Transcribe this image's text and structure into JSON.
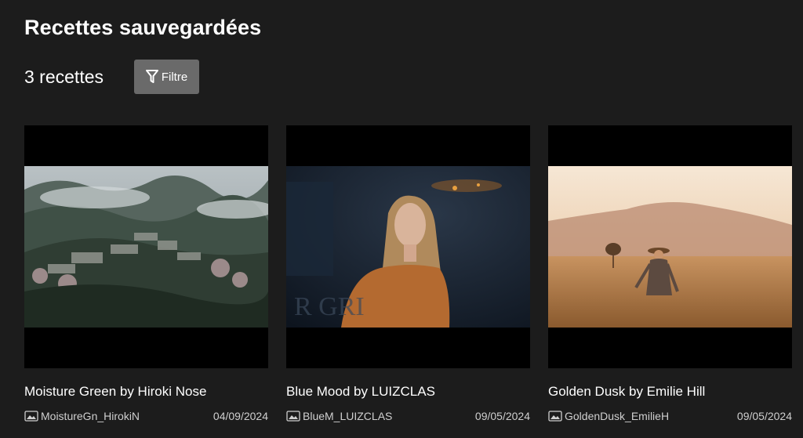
{
  "header": {
    "title": "Recettes sauvegardées",
    "count": "3 recettes",
    "filter_label": "Filtre"
  },
  "recipes": [
    {
      "title": "Moisture Green by Hiroki Nose",
      "file": "MoistureGn_HirokiN",
      "date": "04/09/2024",
      "thumbnail": "misty-mountain-village-icon"
    },
    {
      "title": "Blue Mood by LUIZCLAS",
      "file": "BlueM_LUIZCLAS",
      "date": "09/05/2024",
      "thumbnail": "woman-portrait-night-icon"
    },
    {
      "title": "Golden Dusk by Emilie Hill",
      "file": "GoldenDusk_EmilieH",
      "date": "09/05/2024",
      "thumbnail": "golden-field-woman-icon"
    }
  ],
  "colors": {
    "background": "#1c1c1c",
    "button": "#6a6a6a"
  }
}
